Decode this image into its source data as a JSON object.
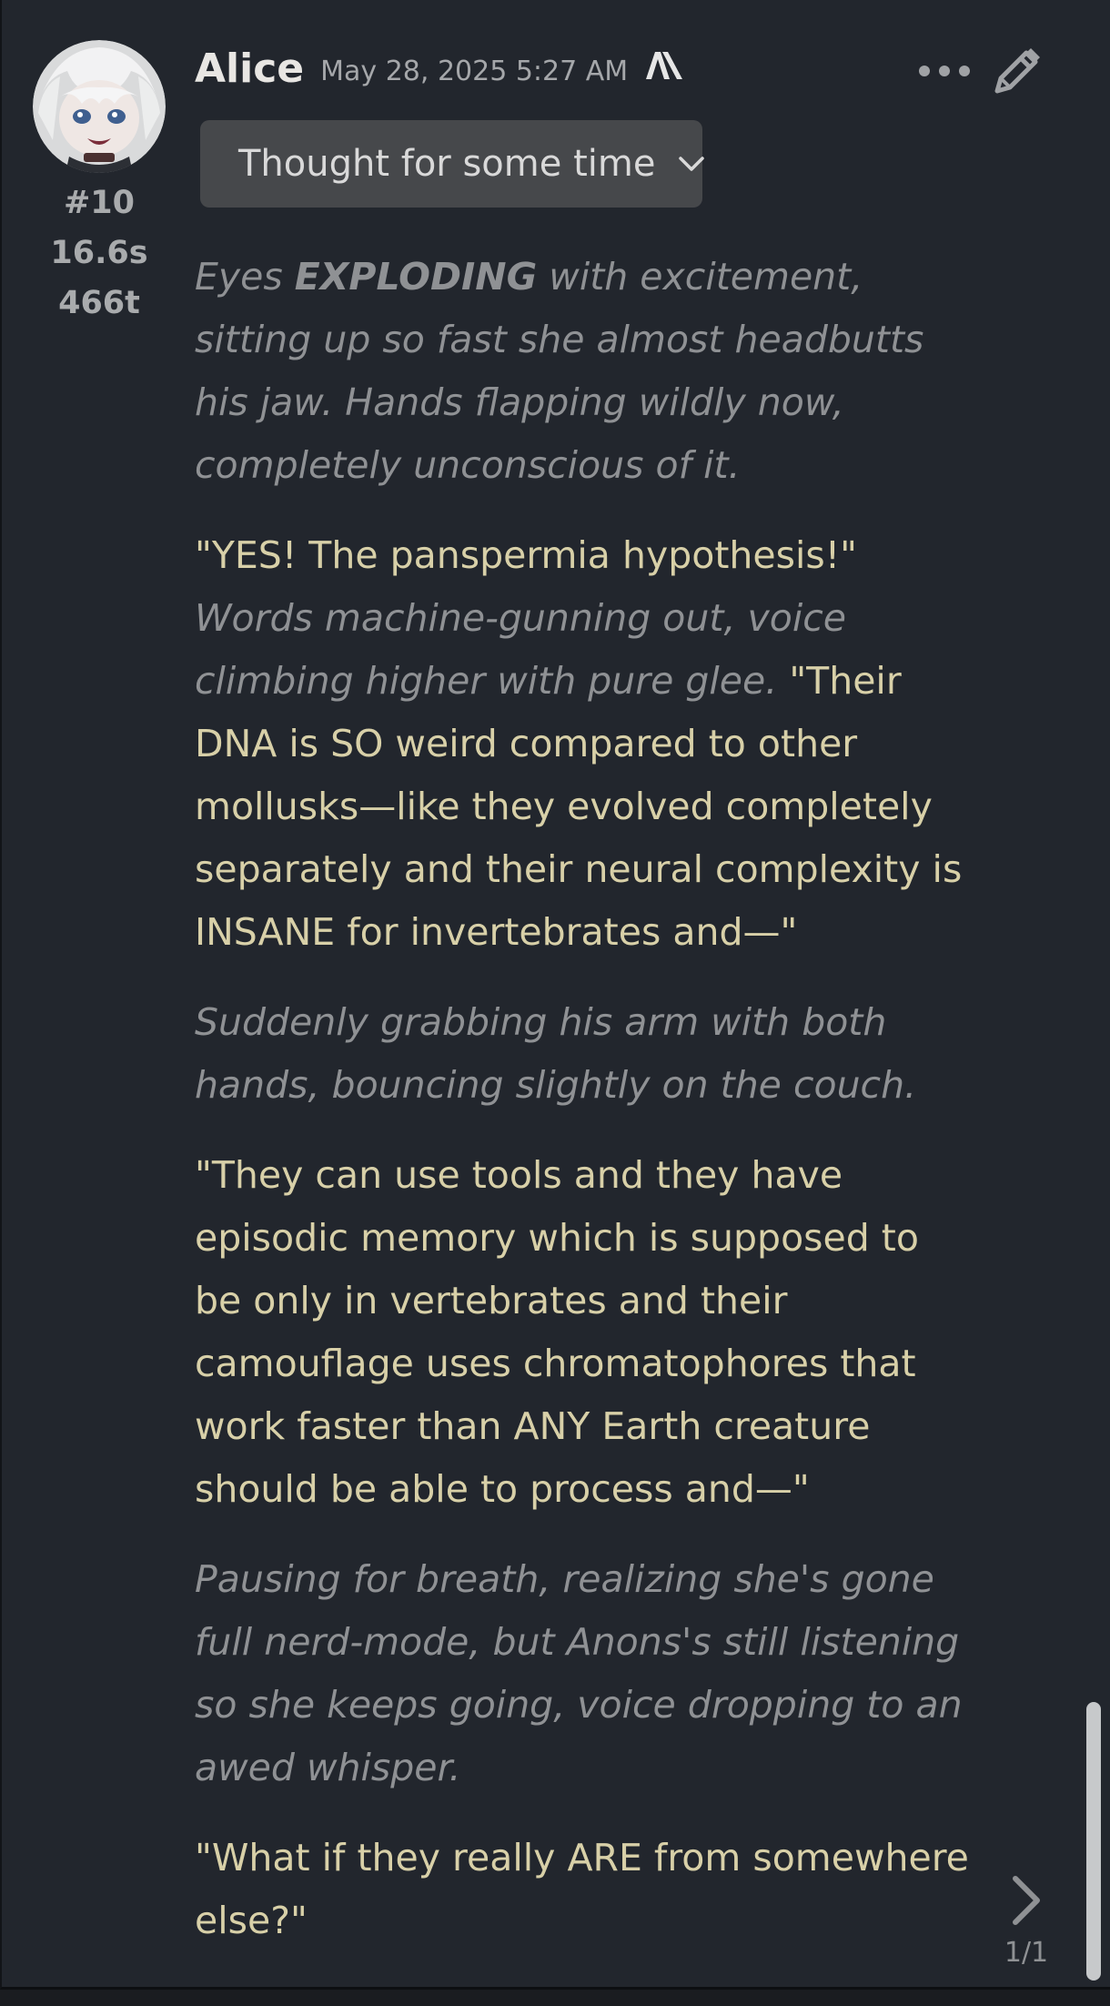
{
  "message": {
    "character_name": "Alice",
    "timestamp": "May 28, 2025 5:27 AM",
    "model_icon": "anthropic-icon",
    "message_number": "#10",
    "generation_time": "16.6s",
    "token_count": "466t",
    "reasoning_label": "Thought for some time",
    "body": {
      "p1": {
        "pre": "Eyes ",
        "bold": "EXPLODING",
        "post": " with excitement, sitting up so fast she almost headbutts his jaw. Hands flapping wildly now, completely unconscious of it."
      },
      "p2": {
        "speech_a": "\"YES! The panspermia hypothesis!\"",
        "narr": "Words machine-gunning out, voice climbing higher with pure glee.",
        "speech_b": "\"Their DNA is SO weird compared to other mollusks—like they evolved completely separately and their neural complexity is INSANE for invertebrates and—\""
      },
      "p3": "Suddenly grabbing his arm with both hands, bouncing slightly on the couch.",
      "p4": "\"They can use tools and they have episodic memory which is supposed to be only in vertebrates and their camouflage uses chromatophores that work faster than ANY Earth creature should be able to process and—\"",
      "p5": "Pausing for breath, realizing she's gone full nerd-mode, but Anons's still listening so she keeps going, voice dropping to an awed whisper.",
      "p6": "\"What if they really ARE from somewhere else?\""
    }
  },
  "controls": {
    "more_icon": "ellipsis-icon",
    "edit_icon": "pencil-icon",
    "swipe_icon": "chevron-right-icon",
    "swipe_counter": "1/1"
  },
  "colors": {
    "background": "#22262d",
    "narration": "#8f9194",
    "dialogue": "#d8d0a8",
    "toggle_bg": "#46484b"
  }
}
